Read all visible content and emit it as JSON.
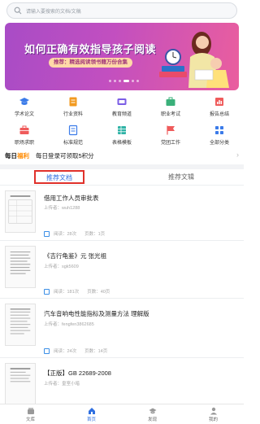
{
  "search": {
    "placeholder": "请输入要搜索的文档/文稿"
  },
  "banner": {
    "headline": "如何正确有效指导孩子阅读",
    "subline": "推荐：精选阅读领书籍万份合集"
  },
  "categories": [
    {
      "label": "学术论文",
      "icon": "graduation-cap-icon",
      "color": "#3b7be9"
    },
    {
      "label": "行业资料",
      "icon": "document-icon",
      "color": "#f29a1f"
    },
    {
      "label": "教育频道",
      "icon": "education-icon",
      "color": "#7b5de6"
    },
    {
      "label": "职业考试",
      "icon": "briefcase-icon",
      "color": "#3ab07a"
    },
    {
      "label": "报告总结",
      "icon": "report-icon",
      "color": "#ef5b5b"
    },
    {
      "label": "职场求职",
      "icon": "job-icon",
      "color": "#ef5b5b"
    },
    {
      "label": "标准规范",
      "icon": "standard-icon",
      "color": "#3b7be9"
    },
    {
      "label": "表格模板",
      "icon": "table-icon",
      "color": "#2fb3a6"
    },
    {
      "label": "党团工作",
      "icon": "flag-icon",
      "color": "#ef5b5b"
    },
    {
      "label": "全部分类",
      "icon": "grid-icon",
      "color": "#3b7be9"
    }
  ],
  "daily": {
    "prefix": "每日",
    "highlight": "福利",
    "text": "每日登录可领取5积分"
  },
  "tabs": {
    "active": "推荐文档",
    "other": "推荐文辑"
  },
  "items": [
    {
      "title": "借用工作人员审批表",
      "uploader": "上传者：wuh1288",
      "reads": "阅读：28次",
      "pages": "页数：1页"
    },
    {
      "title": "《吉行龟鉴》元 张光祖",
      "uploader": "上传者：sgk5609",
      "reads": "阅读：181次",
      "pages": "页数：40页"
    },
    {
      "title": "汽车音响电性能指标及测量方法 理解版",
      "uploader": "上传者：fengfen3862685",
      "reads": "阅读：24次",
      "pages": "页数：14页"
    },
    {
      "title": "【正版】GB 22689-2008",
      "uploader": "上传者：皇室小暗",
      "reads": "",
      "pages": ""
    }
  ],
  "nav": [
    {
      "label": "文库",
      "icon": "library-icon",
      "active": false
    },
    {
      "label": "首页",
      "icon": "home-icon",
      "active": true
    },
    {
      "label": "发现",
      "icon": "discover-icon",
      "active": false
    },
    {
      "label": "我的",
      "icon": "user-icon",
      "active": false
    }
  ],
  "colors": {
    "accent": "#2f6fe0",
    "tab_highlight_border": "#e0312b",
    "bonus": "#ff8a00"
  }
}
